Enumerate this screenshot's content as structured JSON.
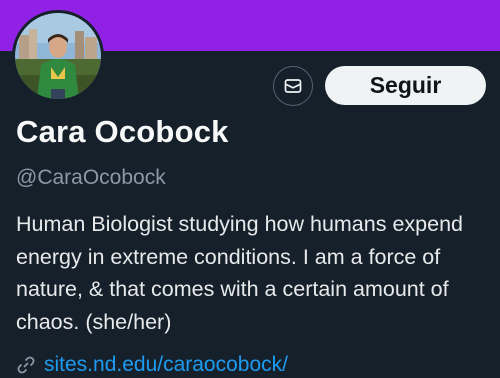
{
  "profile": {
    "display_name": "Cara Ocobock",
    "handle": "@CaraOcobock",
    "bio": "Human Biologist studying how humans expend energy in extreme conditions. I am a force of nature, & that comes with a certain amount of chaos. (she/her)",
    "website": "sites.nd.edu/caraocobock/",
    "banner_color": "#9221e6"
  },
  "actions": {
    "message_icon": "envelope-icon",
    "follow_label": "Seguir"
  },
  "icons": {
    "link": "link-icon"
  }
}
